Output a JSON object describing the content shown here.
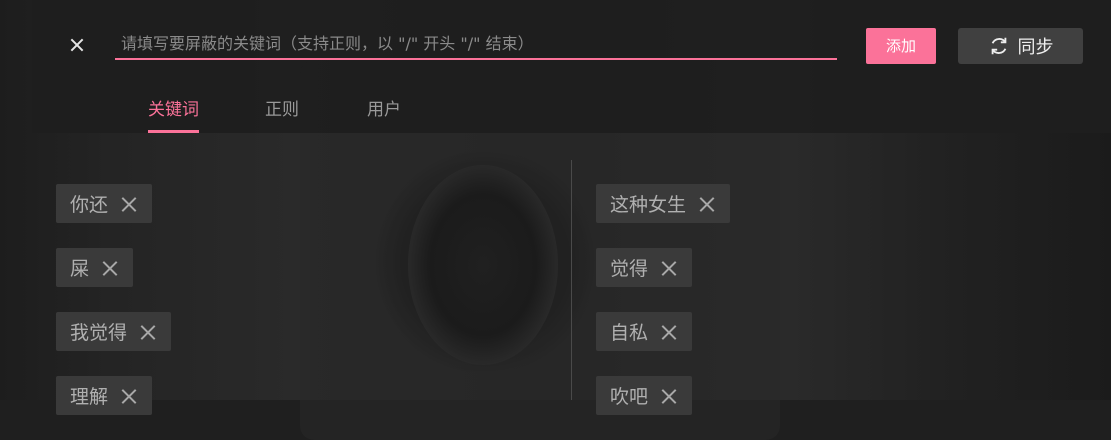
{
  "header": {
    "input_placeholder": "请填写要屏蔽的关键词（支持正则，以 \"/\" 开头 \"/\" 结束）",
    "input_value": "",
    "add_label": "添加",
    "sync_label": "同步",
    "icons": {
      "close": "close-icon",
      "sync": "sync-icon"
    },
    "accent_color": "#fb7299"
  },
  "tabs": [
    {
      "label": "关键词",
      "active": true
    },
    {
      "label": "正则",
      "active": false
    },
    {
      "label": "用户",
      "active": false
    }
  ],
  "keywords": {
    "left": [
      {
        "label": "你还"
      },
      {
        "label": "屎"
      },
      {
        "label": "我觉得"
      },
      {
        "label": "理解"
      }
    ],
    "right": [
      {
        "label": "这种女生"
      },
      {
        "label": "觉得"
      },
      {
        "label": "自私"
      },
      {
        "label": "吹吧"
      }
    ]
  }
}
